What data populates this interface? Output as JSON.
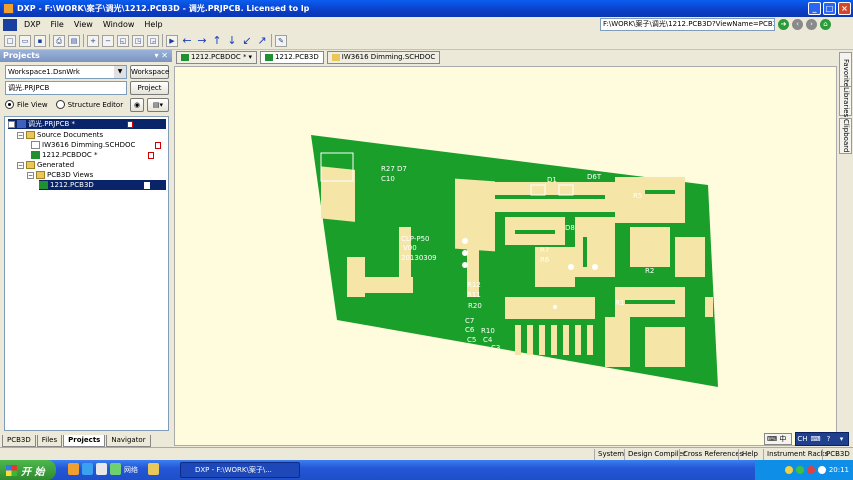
{
  "window": {
    "title": "DXP - F:\\WORK\\案子\\调光\\1212.PCB3D - 调光.PRJPCB. Licensed to lp"
  },
  "menu": {
    "items": [
      "DXP",
      "File",
      "View",
      "Window",
      "Help"
    ]
  },
  "address": {
    "path": "F:\\WORK\\案子\\调光\\1212.PCB3D?ViewName=PCB3D"
  },
  "toolbar": {
    "icons": [
      "new-icon",
      "open-icon",
      "save-icon",
      "print-icon",
      "print-preview-icon",
      "zoom-in-icon",
      "zoom-out-icon",
      "zoom-area-icon",
      "zoom-fit-icon",
      "zoom-all-icon",
      "run-icon",
      "back-arrow-icon",
      "forward-arrow-icon",
      "up-arrow-icon",
      "down-arrow-icon",
      "down-left-arrow-icon",
      "up-right-arrow-icon",
      "tools-icon"
    ]
  },
  "projects_panel": {
    "header": "Projects",
    "workspace_value": "Workspace1.DsnWrk",
    "workspace_button": "Workspace",
    "project_value": "调光.PRJPCB",
    "project_button": "Project",
    "file_view_label": "File View",
    "structure_editor_label": "Structure Editor",
    "tree": [
      {
        "label": "调光.PRJPCB *",
        "level": 0,
        "kind": "project",
        "selected": true
      },
      {
        "label": "Source Documents",
        "level": 1,
        "kind": "folder"
      },
      {
        "label": "IW3616 Dimming.SCHDOC",
        "level": 2,
        "kind": "doc"
      },
      {
        "label": "1212.PCBDOC *",
        "level": 2,
        "kind": "pcb"
      },
      {
        "label": "Generated",
        "level": 1,
        "kind": "folder"
      },
      {
        "label": "PCB3D Views",
        "level": 2,
        "kind": "folder"
      },
      {
        "label": "1212.PCB3D",
        "level": 3,
        "kind": "pcb",
        "selected": true
      }
    ],
    "tabs": [
      "PCB3D",
      "Files",
      "Projects",
      "Navigator"
    ],
    "active_tab": "Projects"
  },
  "document_tabs": [
    {
      "label": "1212.PCBDOC *",
      "kind": "pcb"
    },
    {
      "label": "1212.PCB3D",
      "kind": "pcb",
      "active": true
    },
    {
      "label": "IW3616 Dimming.SCHDOC",
      "kind": "sch"
    }
  ],
  "right_tabs": [
    "Favorites",
    "Libraries",
    "Clipboard"
  ],
  "pcb_labels": [
    "R27 D7",
    "C10",
    "CLP-P50",
    "V00",
    "20130309",
    "D1",
    "D6T",
    "D8",
    "R5",
    "R7",
    "R6",
    "R12",
    "R11",
    "R20",
    "C7",
    "C6",
    "C5",
    "R10",
    "R1",
    "R2",
    "C4",
    "C3"
  ],
  "colors": {
    "board": "#1a9f2b",
    "copper": "#f5e6a8",
    "background": "#fefcdc"
  },
  "status_bar": [
    "System",
    "Design Compiler",
    "Cross References",
    "Help",
    "Instrument Racks",
    "PCB3D"
  ],
  "taskbar": {
    "start_label": "开 始",
    "network_label": "网络",
    "task_label": "DXP - F:\\WORK\\案子\\...",
    "clock": "20:11",
    "lang": "CH",
    "ime_label": "中"
  }
}
